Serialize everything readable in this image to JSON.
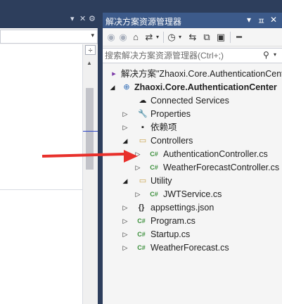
{
  "left_pane": {
    "pin_label": "▾",
    "close_label": "✕",
    "gear_label": "⚙",
    "dropdown_arrow": "▾",
    "split_glyph": "÷",
    "scroll_up": "▲"
  },
  "solution_explorer": {
    "title": "解决方案资源管理器",
    "title_controls": {
      "dropdown": "▾",
      "pin": "ㅍ",
      "close": "✕"
    },
    "toolbar": {
      "back": "◉",
      "forward": "◉",
      "home": "⌂",
      "sync": "⇄",
      "sync_drop": "▾",
      "history": "◷",
      "history_drop": "▾",
      "switch": "⇆",
      "copy": "⧉",
      "props": "▣",
      "more": "━"
    },
    "search": {
      "placeholder": "搜索解决方案资源管理器(Ctrl+;)",
      "icon": "⚲",
      "drop": "▾"
    },
    "tree": [
      {
        "label": "解决方案\"Zhaoxi.Core.AuthenticationCenter\"",
        "icon": "▸",
        "icon_class": "ic-sol",
        "bold": false,
        "expander": ""
      },
      {
        "label": "Zhaoxi.Core.AuthenticationCenter",
        "icon": "⊕",
        "icon_class": "ic-proj",
        "bold": true,
        "expander": "◢"
      },
      {
        "label": "Connected Services",
        "icon": "☁",
        "icon_class": "",
        "bold": false,
        "expander": ""
      },
      {
        "label": "Properties",
        "icon": "🔧",
        "icon_class": "ic-folder",
        "bold": false,
        "expander": "▷"
      },
      {
        "label": "依赖项",
        "icon": "▪",
        "icon_class": "",
        "bold": false,
        "expander": "▷"
      },
      {
        "label": "Controllers",
        "icon": "▭",
        "icon_class": "ic-folder",
        "bold": false,
        "expander": "◢"
      },
      {
        "label": "AuthenticationController.cs",
        "icon": "C#",
        "icon_class": "ic-cs",
        "bold": false,
        "expander": "▷"
      },
      {
        "label": "WeatherForecastController.cs",
        "icon": "C#",
        "icon_class": "ic-cs",
        "bold": false,
        "expander": "▷"
      },
      {
        "label": "Utility",
        "icon": "▭",
        "icon_class": "ic-folder",
        "bold": false,
        "expander": "◢"
      },
      {
        "label": "JWTService.cs",
        "icon": "C#",
        "icon_class": "ic-cs",
        "bold": false,
        "expander": "▷"
      },
      {
        "label": "appsettings.json",
        "icon": "{}",
        "icon_class": "ic-json",
        "bold": false,
        "expander": "▷"
      },
      {
        "label": "Program.cs",
        "icon": "C#",
        "icon_class": "ic-cs",
        "bold": false,
        "expander": "▷"
      },
      {
        "label": "Startup.cs",
        "icon": "C#",
        "icon_class": "ic-cs",
        "bold": false,
        "expander": "▷"
      },
      {
        "label": "WeatherForecast.cs",
        "icon": "C#",
        "icon_class": "ic-cs",
        "bold": false,
        "expander": "▷"
      }
    ]
  },
  "colors": {
    "chrome": "#2d3e5c",
    "title_active": "#3c5a8a",
    "arrow": "#e8302b"
  }
}
